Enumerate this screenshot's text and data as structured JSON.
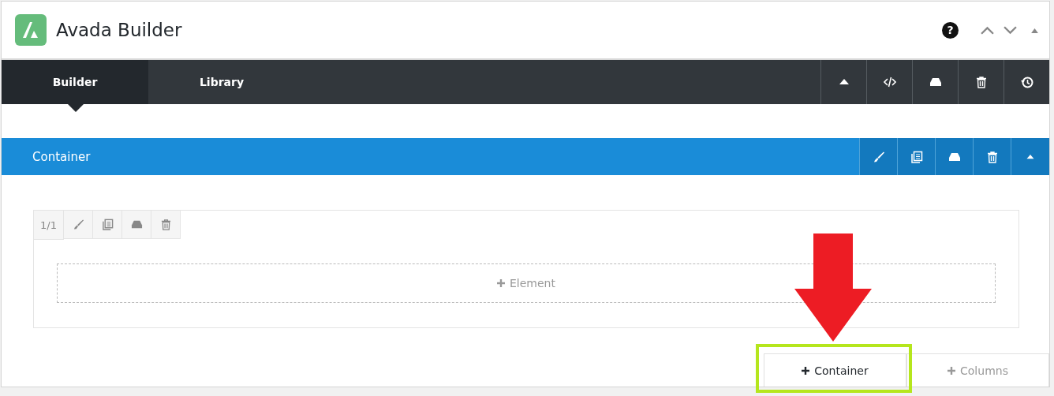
{
  "header": {
    "title": "Avada Builder",
    "help": "?"
  },
  "tabs": [
    {
      "label": "Builder",
      "selected": true
    },
    {
      "label": "Library",
      "selected": false
    }
  ],
  "toolbar": {
    "icons": [
      {
        "kind": "collapse"
      },
      {
        "kind": "code"
      },
      {
        "kind": "save"
      },
      {
        "kind": "delete"
      },
      {
        "kind": "history"
      }
    ]
  },
  "container": {
    "title": "Container",
    "icons": [
      {
        "kind": "edit"
      },
      {
        "kind": "clone"
      },
      {
        "kind": "save"
      },
      {
        "kind": "delete"
      },
      {
        "kind": "collapse"
      }
    ],
    "column": {
      "size": "1/1",
      "icons": [
        {
          "kind": "edit"
        },
        {
          "kind": "clone"
        },
        {
          "kind": "save"
        },
        {
          "kind": "delete"
        }
      ],
      "add_element": "Element"
    }
  },
  "bottom_buttons": [
    {
      "label": "Container",
      "primary": true
    },
    {
      "label": "Columns",
      "primary": false
    }
  ]
}
